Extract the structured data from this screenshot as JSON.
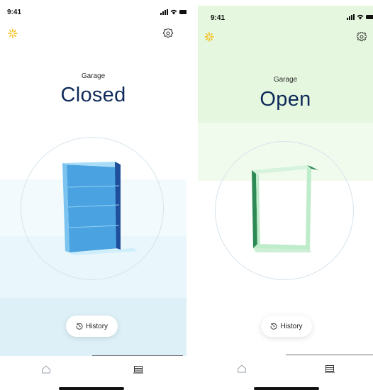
{
  "screens": [
    {
      "status_time": "9:41",
      "device_label": "Garage",
      "state": "Closed",
      "door_status": "closed",
      "history_label": "History",
      "icons": [
        "sparkle-icon",
        "gear-icon",
        "history-icon",
        "home-icon",
        "garage-icon"
      ]
    },
    {
      "status_time": "9:41",
      "device_label": "Garage",
      "state": "Open",
      "door_status": "open",
      "history_label": "History",
      "icons": [
        "sparkle-icon",
        "gear-icon",
        "history-icon",
        "home-icon",
        "garage-icon"
      ]
    }
  ],
  "colors": {
    "accent": "#f5b800",
    "state_text": "#0f2a5a",
    "closed_door": "#4aa3e0",
    "open_frame": "#bfeccb",
    "open_frame_dark": "#2e8a55"
  }
}
